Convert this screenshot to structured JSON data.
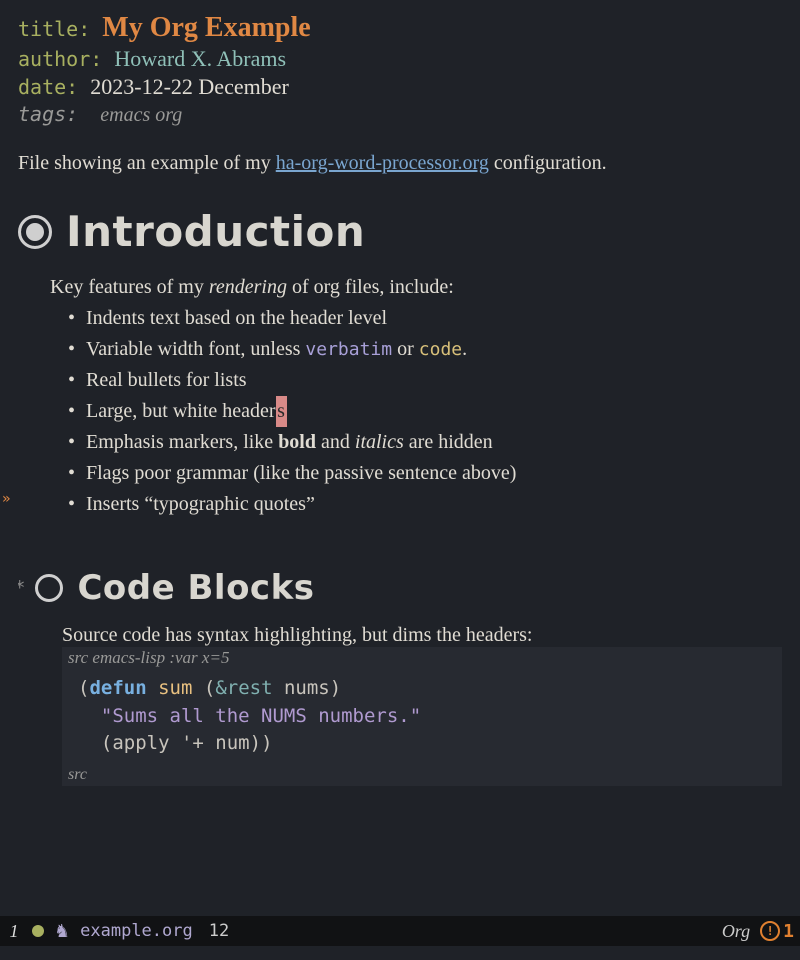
{
  "meta": {
    "title_key": "title:",
    "title_val": "My Org Example",
    "author_key": "author:",
    "author_val": "Howard X. Abrams",
    "date_key": "date:",
    "date_val": "2023-12-22 December",
    "tags_key": "tags:",
    "tags_val": "emacs org"
  },
  "intro": {
    "prefix": "File showing an example of my ",
    "link_text": "ha-org-word-processor.org",
    "suffix": " configuration."
  },
  "h1": {
    "text": "Introduction"
  },
  "features": {
    "lead_prefix": "Key features of my ",
    "lead_em": "rendering",
    "lead_suffix": " of org files, include:",
    "items": {
      "0": "Indents text based on the header level",
      "1a": "Variable width font, unless ",
      "1b": "verbatim",
      "1c": " or ",
      "1d": "code",
      "1e": ".",
      "2": "Real bullets for lists",
      "3a": "Large, but white header",
      "3b": "s",
      "4a": "Emphasis markers, like ",
      "4b": "bold",
      "4c": " and ",
      "4d": "italics",
      "4e": " are hidden",
      "5": "Flags poor grammar (like the passive sentence above)",
      "6": "Inserts “typographic quotes”"
    }
  },
  "h2": {
    "star": "*",
    "text": "Code Blocks"
  },
  "src": {
    "caption": "Source code has syntax highlighting, but dims the headers:",
    "begin": "src emacs-lisp :var x=5",
    "l1a": "(",
    "l1b": "defun",
    "l1c": " ",
    "l1d": "sum",
    "l1e": " (",
    "l1f": "&rest",
    "l1g": " ",
    "l1h": "nums",
    "l1i": ")",
    "l2": "\"Sums all the NUMS numbers.\"",
    "l3a": "(",
    "l3b": "apply '+ num",
    "l3c": "))",
    "end": "src"
  },
  "modeline": {
    "win": "1",
    "file": "example.org",
    "line": "12",
    "mode": "Org",
    "warn_count": "1",
    "horse": "♞"
  },
  "gutter": {
    "mark": "»"
  }
}
